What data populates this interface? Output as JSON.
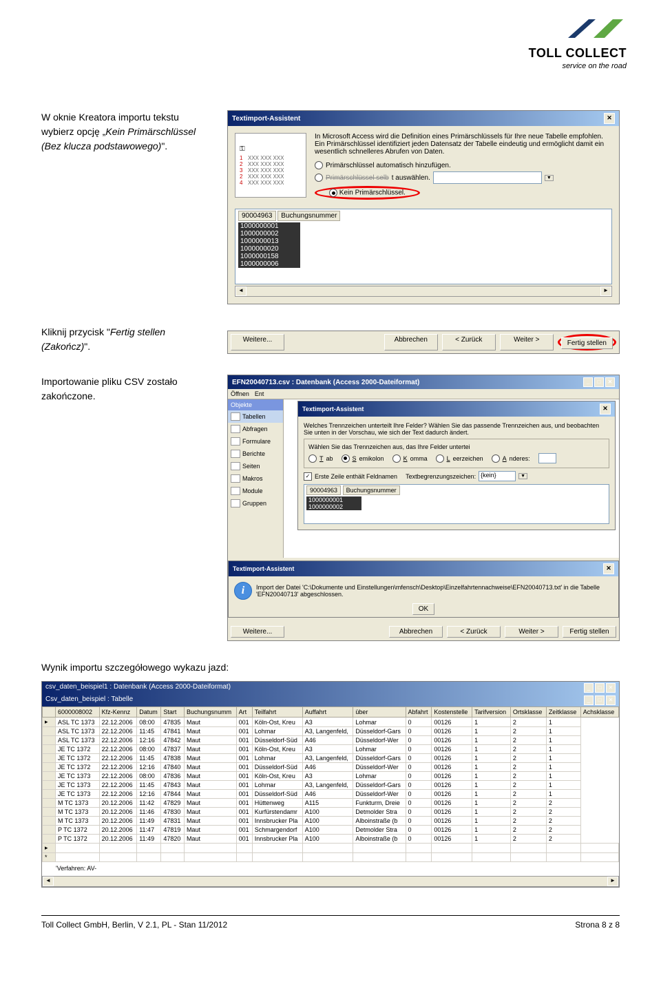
{
  "logo": {
    "brand": "TOLL COLLECT",
    "tagline": "service on the road"
  },
  "sec1": {
    "text_a": "W oknie Kreatora importu tekstu wybierz opcję „",
    "text_b": "Kein Primärschlüssel (Bez klucza podstawowego)",
    "text_c": "\".",
    "dialog_title": "Textimport-Assistent",
    "desc": "In Microsoft Access wird die Definition eines Primärschlüssels für Ihre neue Tabelle empfohlen. Ein Primärschlüssel identifiziert jeden Datensatz der Tabelle eindeutig und ermöglicht damit ein wesentlich schnelleres Abrufen von Daten.",
    "radio1": "Primärschlüssel automatisch hinzufügen.",
    "radio2_pre": "Primärschlüssel selb",
    "radio2_post": "t auswählen.",
    "radio3": "Kein Primärschlüssel.",
    "key_rows": [
      [
        "1",
        "XXX XXX XXX"
      ],
      [
        "2",
        "XXX XXX XXX"
      ],
      [
        "3",
        "XXX XXX XXX"
      ],
      [
        "2",
        "XXX XXX XXX"
      ],
      [
        "4",
        "XXX XXX XXX"
      ]
    ],
    "list_head_id": "90004963",
    "list_head_name": "Buchungsnummer",
    "list_items": [
      "1000000001",
      "1000000002",
      "1000000013",
      "1000000020",
      "1000000158",
      "1000000006"
    ],
    "buttons": [
      "Weitere...",
      "Abbrechen",
      "< Zurück",
      "Weiter >",
      "Fertig stellen"
    ]
  },
  "sec2_text": "Kliknij przycisk \"Fertig stellen (Zakończ)\".",
  "sec2_text_a": "Kliknij przycisk \"",
  "sec2_text_b": "Fertig stellen (Zakończ)",
  "sec2_text_c": "\".",
  "sec3": {
    "text": "Importowanie pliku CSV zostało zakończone.",
    "db_title": "EFN20040713.csv : Datenbank (Access 2000-Dateiformat)",
    "toolbar": {
      "open": "Öffnen",
      "ent": "Ent"
    },
    "objects_header": "Objekte",
    "objects": [
      "Tabellen",
      "Abfragen",
      "Formulare",
      "Berichte",
      "Seiten",
      "Makros",
      "Module",
      "Gruppen"
    ],
    "inner_title": "Textimport-Assistent",
    "inner_desc": "Welches Trennzeichen unterteilt Ihre Felder? Wählen Sie das passende Trennzeichen aus, und beobachten Sie unten in der Vorschau, wie sich der Text dadurch ändert.",
    "fs_label": "Wählen Sie das Trennzeichen aus, das Ihre Felder untertei",
    "radios": [
      [
        "Tab",
        false
      ],
      [
        "Semikolon",
        true
      ],
      [
        "Komma",
        false
      ],
      [
        "Leerzeichen",
        false
      ],
      [
        "Anderes:",
        false
      ]
    ],
    "chk_label": "Erste Zeile enthält Feldnamen",
    "textq_label": "Textbegrenzungszeichen:",
    "textq_value": "{kein}",
    "list_head_id": "90004963",
    "list_head_name": "Buchungsnummer",
    "list_items": [
      "1000000001",
      "1000000002"
    ],
    "msg_title": "Textimport-Assistent",
    "msg_text": "Import der Datei 'C:\\Dokumente und Einstellungen\\mfensch\\Desktop\\Einzelfahrtennachweise\\EFN20040713.txt' in die Tabelle 'EFN20040713' abgeschlossen.",
    "ok": "OK",
    "buttons": [
      "Weitere...",
      "Abbrechen",
      "< Zurück",
      "Weiter >",
      "Fertig stellen"
    ]
  },
  "sec4_heading": "Wynik importu szczegółowego wykazu jazd:",
  "table": {
    "db_title": "csv_daten_beispiel1 : Datenbank (Access 2000-Dateiformat)",
    "tab_title": "Csv_daten_beispiel : Tabelle",
    "columns": [
      "6000008002",
      "Kfz-Kennz",
      "Datum",
      "Start",
      "Buchungsnumm",
      "Art",
      "Teilfahrt",
      "Auffahrt",
      "über",
      "Abfahrt",
      "Kostenstelle",
      "Tarifversion",
      "Ortsklasse",
      "Zeitklasse",
      "Achsklasse"
    ],
    "rows": [
      [
        "",
        "ASL TC 1373",
        "22.12.2006",
        "08:00",
        "47835",
        "Maut",
        "001",
        "Köln-Ost, Kreu",
        "A3",
        "Lohmar",
        "0",
        "00126",
        "1",
        "2",
        "1"
      ],
      [
        "",
        "ASL TC 1373",
        "22.12.2006",
        "11:45",
        "47841",
        "Maut",
        "001",
        "Lohmar",
        "A3, Langenfeld,",
        "Düsseldorf-Gars",
        "0",
        "00126",
        "1",
        "2",
        "1"
      ],
      [
        "",
        "ASL TC 1373",
        "22.12.2006",
        "12:16",
        "47842",
        "Maut",
        "001",
        "Düsseldorf-Süd",
        "A46",
        "Düsseldorf-Wer",
        "0",
        "00126",
        "1",
        "2",
        "1"
      ],
      [
        "",
        "JE TC 1372",
        "22.12.2006",
        "08:00",
        "47837",
        "Maut",
        "001",
        "Köln-Ost, Kreu",
        "A3",
        "Lohmar",
        "0",
        "00126",
        "1",
        "2",
        "1"
      ],
      [
        "",
        "JE TC 1372",
        "22.12.2006",
        "11:45",
        "47838",
        "Maut",
        "001",
        "Lohmar",
        "A3, Langenfeld,",
        "Düsseldorf-Gars",
        "0",
        "00126",
        "1",
        "2",
        "1"
      ],
      [
        "",
        "JE TC 1372",
        "22.12.2006",
        "12:16",
        "47840",
        "Maut",
        "001",
        "Düsseldorf-Süd",
        "A46",
        "Düsseldorf-Wer",
        "0",
        "00126",
        "1",
        "2",
        "1"
      ],
      [
        "",
        "JE TC 1373",
        "22.12.2006",
        "08:00",
        "47836",
        "Maut",
        "001",
        "Köln-Ost, Kreu",
        "A3",
        "Lohmar",
        "0",
        "00126",
        "1",
        "2",
        "1"
      ],
      [
        "",
        "JE TC 1373",
        "22.12.2006",
        "11:45",
        "47843",
        "Maut",
        "001",
        "Lohmar",
        "A3, Langenfeld,",
        "Düsseldorf-Gars",
        "0",
        "00126",
        "1",
        "2",
        "1"
      ],
      [
        "",
        "JE TC 1373",
        "22.12.2006",
        "12:16",
        "47844",
        "Maut",
        "001",
        "Düsseldorf-Süd",
        "A46",
        "Düsseldorf-Wer",
        "0",
        "00126",
        "1",
        "2",
        "1"
      ],
      [
        "",
        "M TC 1373",
        "20.12.2006",
        "11:42",
        "47829",
        "Maut",
        "001",
        "Hüttenweg",
        "A115",
        "Funkturm, Dreie",
        "0",
        "00126",
        "1",
        "2",
        "2"
      ],
      [
        "",
        "M TC 1373",
        "20.12.2006",
        "11:46",
        "47830",
        "Maut",
        "001",
        "Kurfürstendamr",
        "A100",
        "Detmolder Stra",
        "0",
        "00126",
        "1",
        "2",
        "2"
      ],
      [
        "",
        "M TC 1373",
        "20.12.2006",
        "11:49",
        "47831",
        "Maut",
        "001",
        "Innsbrucker Pla",
        "A100",
        "Alboinstraße (b",
        "0",
        "00126",
        "1",
        "2",
        "2"
      ],
      [
        "",
        "P TC 1372",
        "20.12.2006",
        "11:47",
        "47819",
        "Maut",
        "001",
        "Schmargendorf",
        "A100",
        "Detmolder Stra",
        "0",
        "00126",
        "1",
        "2",
        "2"
      ],
      [
        "",
        "P TC 1372",
        "20.12.2006",
        "11:49",
        "47820",
        "Maut",
        "001",
        "Innsbrucker Pla",
        "A100",
        "Alboinstraße (b",
        "0",
        "00126",
        "1",
        "2",
        "2"
      ]
    ],
    "footer_note": "'Verfahren: AV-"
  },
  "footer": {
    "left": "Toll Collect GmbH, Berlin, V 2.1, PL - Stan 11/2012",
    "right": "Strona 8 z 8"
  }
}
